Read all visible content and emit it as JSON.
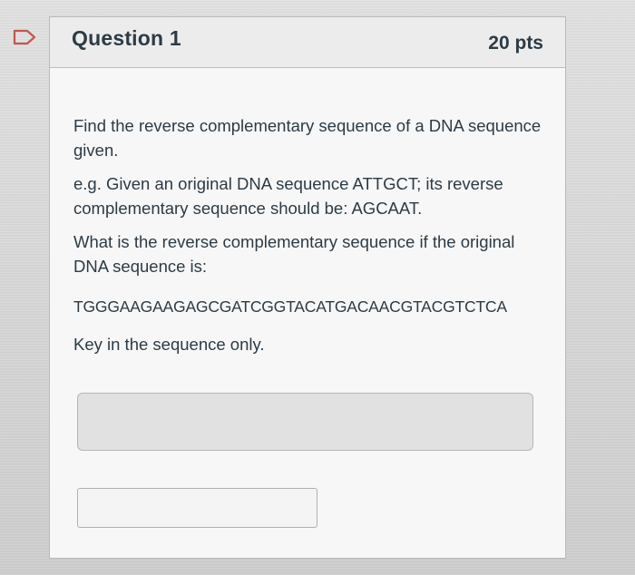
{
  "question": {
    "title": "Question 1",
    "points": "20 pts",
    "paragraphs": [
      "Find the reverse complementary sequence of a DNA sequence given.",
      "e.g. Given an original DNA sequence ATTGCT; its reverse complementary sequence should be: AGCAAT.",
      "What is the reverse complementary sequence if the original DNA sequence is:"
    ],
    "sequence": "TGGGAAGAAGAGCGATCGGTACATGACAACGTACGTCTCA",
    "instruction": "Key in the sequence only."
  },
  "answer": {
    "textarea_value": "",
    "input_value": ""
  },
  "icons": {
    "flag": "bookmark-flag-icon"
  },
  "colors": {
    "flag_accent": "#c0574f",
    "text": "#2d3b45"
  }
}
